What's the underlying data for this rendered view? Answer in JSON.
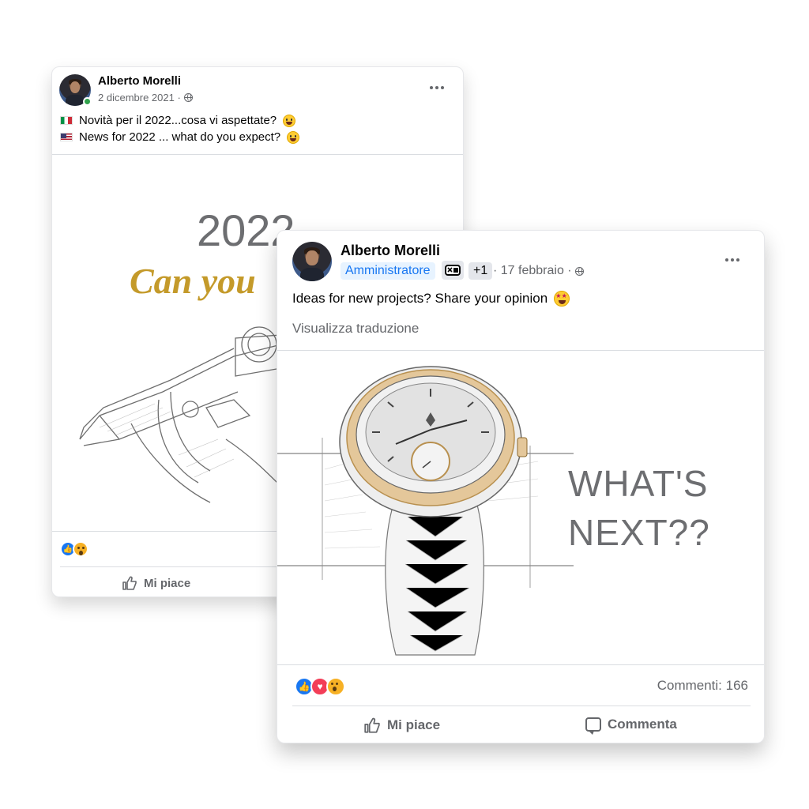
{
  "post_back": {
    "author": "Alberto Morelli",
    "date": "2 dicembre 2021 ·",
    "lines": [
      {
        "flag": "italy-flag",
        "text": "Novità per il 2022...cosa vi aspettate?"
      },
      {
        "flag": "usa-flag",
        "text": "News for 2022 ... what do you expect?"
      }
    ],
    "image": {
      "year": "2022",
      "tagline": "Can you"
    },
    "like_label": "Mi piace"
  },
  "post_front": {
    "author": "Alberto Morelli",
    "role_badge": "Amministratore",
    "extra_badge": "+1",
    "date": "· 17 febbraio ·",
    "text": "Ideas for new projects? Share your opinion",
    "translate_link": "Visualizza traduzione",
    "image": {
      "line1": "WHAT'S",
      "line2": "NEXT??"
    },
    "comments_count": "Commenti: 166",
    "like_label": "Mi piace",
    "comment_label": "Commenta"
  },
  "colors": {
    "accent": "#1877f2",
    "gold": "#c49a2a",
    "love": "#f33e58",
    "wow": "#f7b125"
  }
}
